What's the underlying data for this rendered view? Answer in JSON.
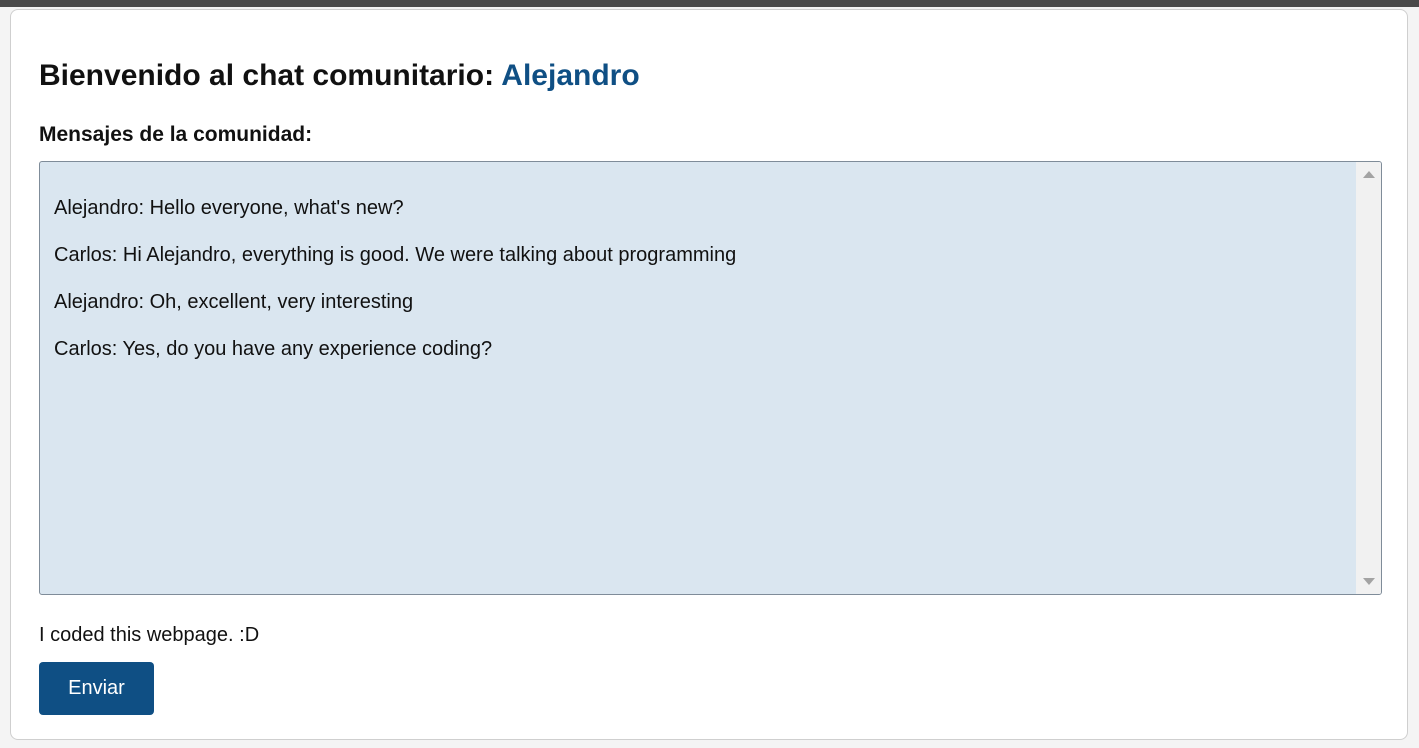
{
  "header": {
    "welcome_text": "Bienvenido al chat comunitario: ",
    "username": "Alejandro"
  },
  "chat": {
    "section_label": "Mensajes de la comunidad:",
    "messages": [
      "Alejandro: Hello everyone, what's new?",
      "Carlos: Hi Alejandro, everything is good. We were talking about programming",
      "Alejandro: Oh, excellent, very interesting",
      "Carlos: Yes, do you have any experience coding?"
    ]
  },
  "composer": {
    "input_value": "I coded this webpage. :D",
    "send_label": "Enviar"
  },
  "colors": {
    "accent": "#0f4f84",
    "messages_background": "#dae6f0"
  }
}
